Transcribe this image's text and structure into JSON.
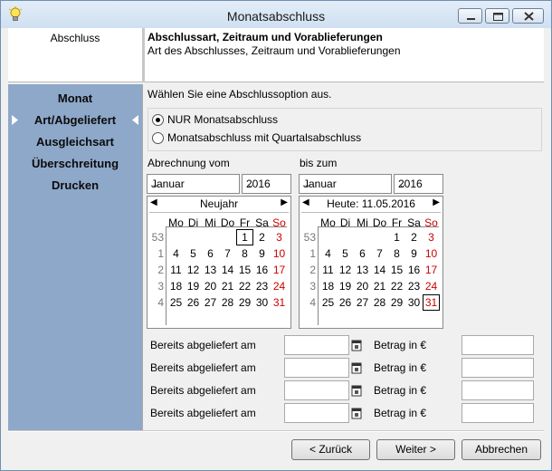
{
  "window": {
    "title": "Monatsabschluss"
  },
  "header": {
    "section": "Abschluss",
    "title": "Abschlussart,  Zeitraum und Vorablieferungen",
    "subtitle": "Art des Abschlusses, Zeitraum und Vorablieferungen"
  },
  "sidebar": {
    "items": [
      {
        "label": "Monat",
        "active": false
      },
      {
        "label": "Art/Abgeliefert",
        "active": true
      },
      {
        "label": "Ausgleichsart",
        "active": false
      },
      {
        "label": "Überschreitung",
        "active": false
      },
      {
        "label": "Drucken",
        "active": false
      }
    ]
  },
  "main": {
    "instruction": "Wählen Sie eine Abschlussoption aus.",
    "options": [
      {
        "label": "NUR Monatsabschluss",
        "selected": true
      },
      {
        "label": "Monatsabschluss mit Quartalsabschluss",
        "selected": false
      }
    ],
    "from": {
      "label": "Abrechnung vom",
      "month": "Januar",
      "year": "2016",
      "calendar_title": "Neujahr"
    },
    "to": {
      "label": "bis zum",
      "month": "Januar",
      "year": "2016",
      "calendar_title": "Heute: 11.05.2016"
    },
    "weekdays": [
      "Mo",
      "Di",
      "Mi",
      "Do",
      "Fr",
      "Sa",
      "So"
    ],
    "weeks": [
      "53",
      "1",
      "2",
      "3",
      "4"
    ],
    "days": [
      [
        "",
        "",
        "",
        "",
        "1",
        "2",
        "3"
      ],
      [
        "4",
        "5",
        "6",
        "7",
        "8",
        "9",
        "10"
      ],
      [
        "11",
        "12",
        "13",
        "14",
        "15",
        "16",
        "17"
      ],
      [
        "18",
        "19",
        "20",
        "21",
        "22",
        "23",
        "24"
      ],
      [
        "25",
        "26",
        "27",
        "28",
        "29",
        "30",
        "31"
      ]
    ],
    "from_selected_day": "1",
    "to_selected_day": "31",
    "delivery_label": "Bereits abgeliefert am",
    "amount_label": "Betrag in €",
    "delivery_rows": 4
  },
  "buttons": {
    "back": "< Zurück",
    "next": "Weiter >",
    "cancel": "Abbrechen"
  },
  "colors": {
    "sidebar": "#8ea8c9",
    "sunday": "#cc0000"
  }
}
